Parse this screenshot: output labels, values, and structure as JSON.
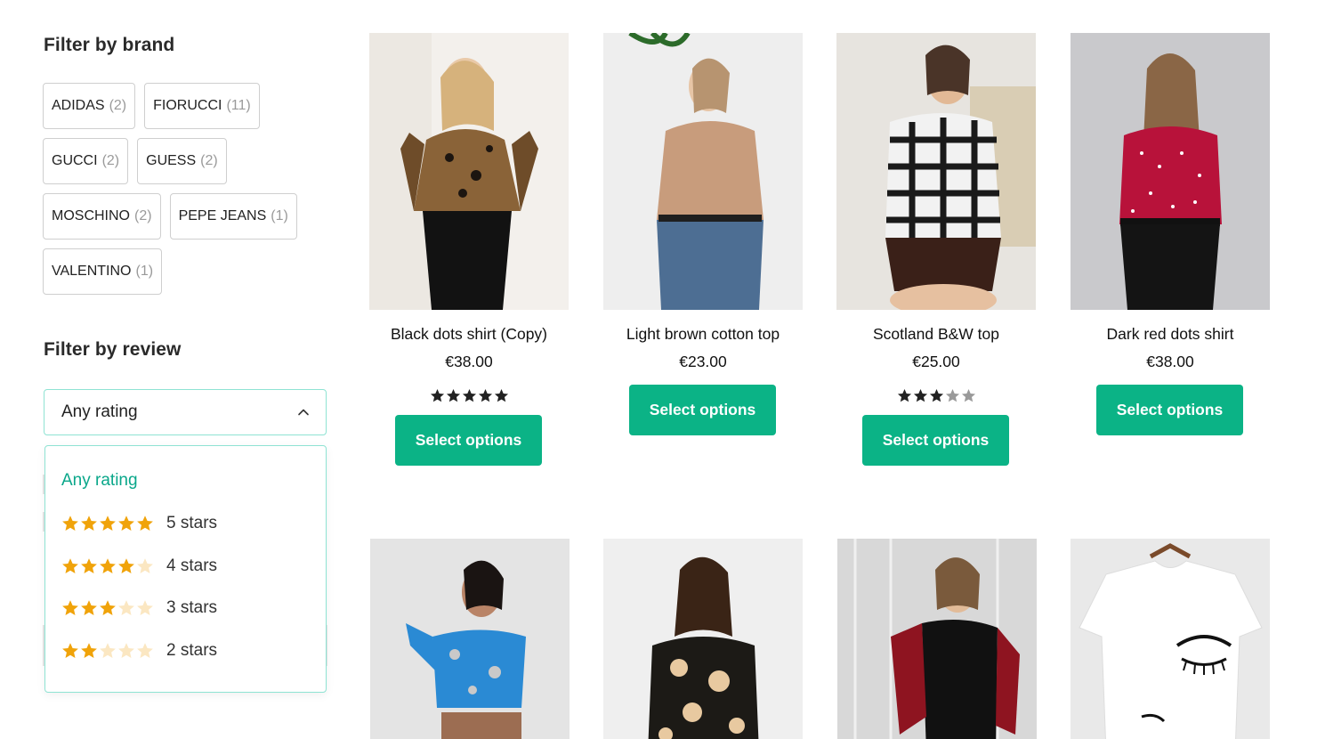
{
  "sidebar": {
    "brand_title": "Filter by brand",
    "brands": [
      {
        "name": "ADIDAS",
        "count": "(2)"
      },
      {
        "name": "FIORUCCI",
        "count": "(11)"
      },
      {
        "name": "GUCCI",
        "count": "(2)"
      },
      {
        "name": "GUESS",
        "count": "(2)"
      },
      {
        "name": "MOSCHINO",
        "count": "(2)"
      },
      {
        "name": "PEPE JEANS",
        "count": "(1)"
      },
      {
        "name": "VALENTINO",
        "count": "(1)"
      }
    ],
    "review_title": "Filter by review",
    "rating_select": {
      "value": "Any rating",
      "icon": "chevron-up-icon"
    },
    "rating_options": [
      {
        "label": "Any rating",
        "stars": 0,
        "active": true
      },
      {
        "label": "5 stars",
        "stars": 5
      },
      {
        "label": "4 stars",
        "stars": 4
      },
      {
        "label": "3 stars",
        "stars": 3
      },
      {
        "label": "2 stars",
        "stars": 2
      }
    ]
  },
  "products": [
    {
      "title": "Black dots shirt (Copy)",
      "price": "€38.00",
      "rating": 5,
      "button": "Select options"
    },
    {
      "title": "Light brown cotton top",
      "price": "€23.00",
      "rating": null,
      "button": "Select options"
    },
    {
      "title": "Scotland B&W top",
      "price": "€25.00",
      "rating": 3,
      "button": "Select options"
    },
    {
      "title": "Dark red dots shirt",
      "price": "€38.00",
      "rating": null,
      "button": "Select options"
    }
  ],
  "colors": {
    "accent": "#0bb386",
    "select_border": "#8fe3d3",
    "star_filled": "#f0a30a",
    "star_empty": "#fbe7c2",
    "rating_dark": "#222222",
    "rating_grey": "#9a9a9a"
  }
}
